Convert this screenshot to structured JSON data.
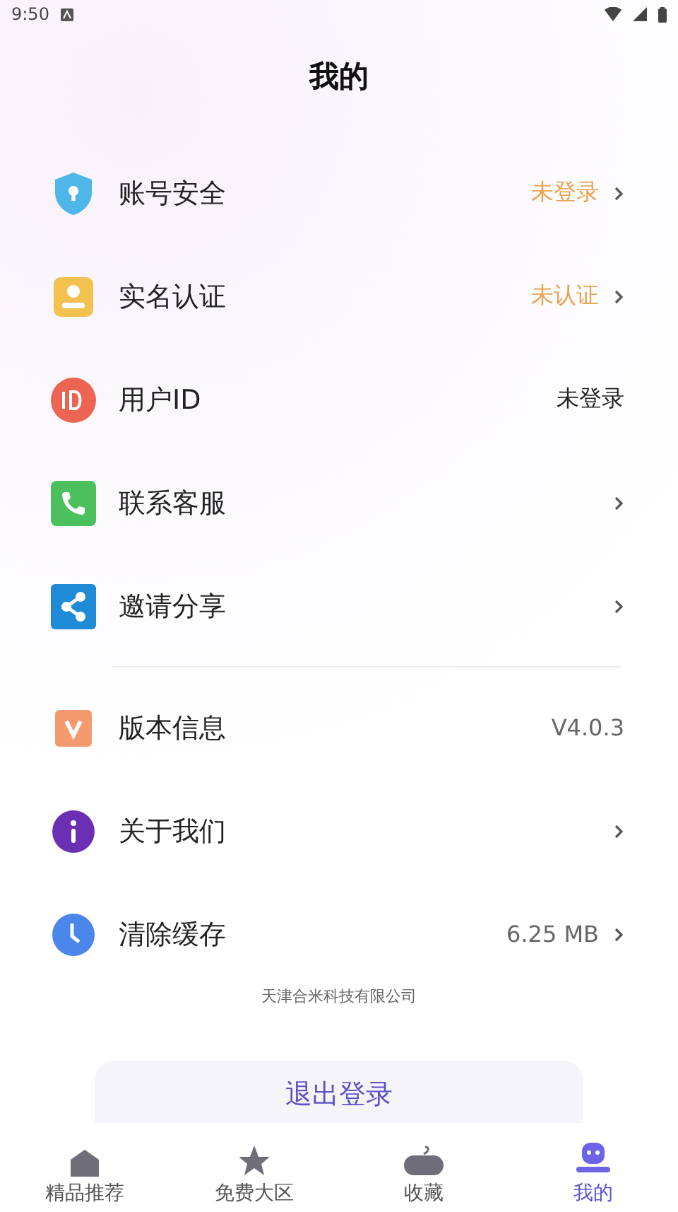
{
  "status_bar": {
    "time": "9:50"
  },
  "title": "我的",
  "sections": [
    {
      "rows": [
        {
          "label": "账号安全",
          "value": "未登录",
          "color": "#e8a34a",
          "chevron": true
        },
        {
          "label": "实名认证",
          "value": "未认证",
          "color": "#e8a34a",
          "chevron": true
        },
        {
          "label": "用户ID",
          "value": "未登录",
          "color": "#222222",
          "chevron": false
        },
        {
          "label": "联系客服",
          "chevron": true
        },
        {
          "label": "邀请分享",
          "chevron": true
        }
      ]
    },
    {
      "rows": [
        {
          "label": "版本信息",
          "value": "V4.0.3",
          "color": "#666666",
          "chevron": false
        },
        {
          "label": "关于我们",
          "chevron": true
        },
        {
          "label": "清除缓存",
          "value": "6.25 MB",
          "color": "#666666",
          "chevron": true
        }
      ]
    }
  ],
  "company": "天津合米科技有限公司",
  "logout_button": "退出登录",
  "tabs": [
    {
      "label": "精品推荐",
      "selected": false
    },
    {
      "label": "免费大区",
      "selected": false
    },
    {
      "label": "收藏",
      "selected": false
    },
    {
      "label": "我的",
      "selected": true
    }
  ]
}
